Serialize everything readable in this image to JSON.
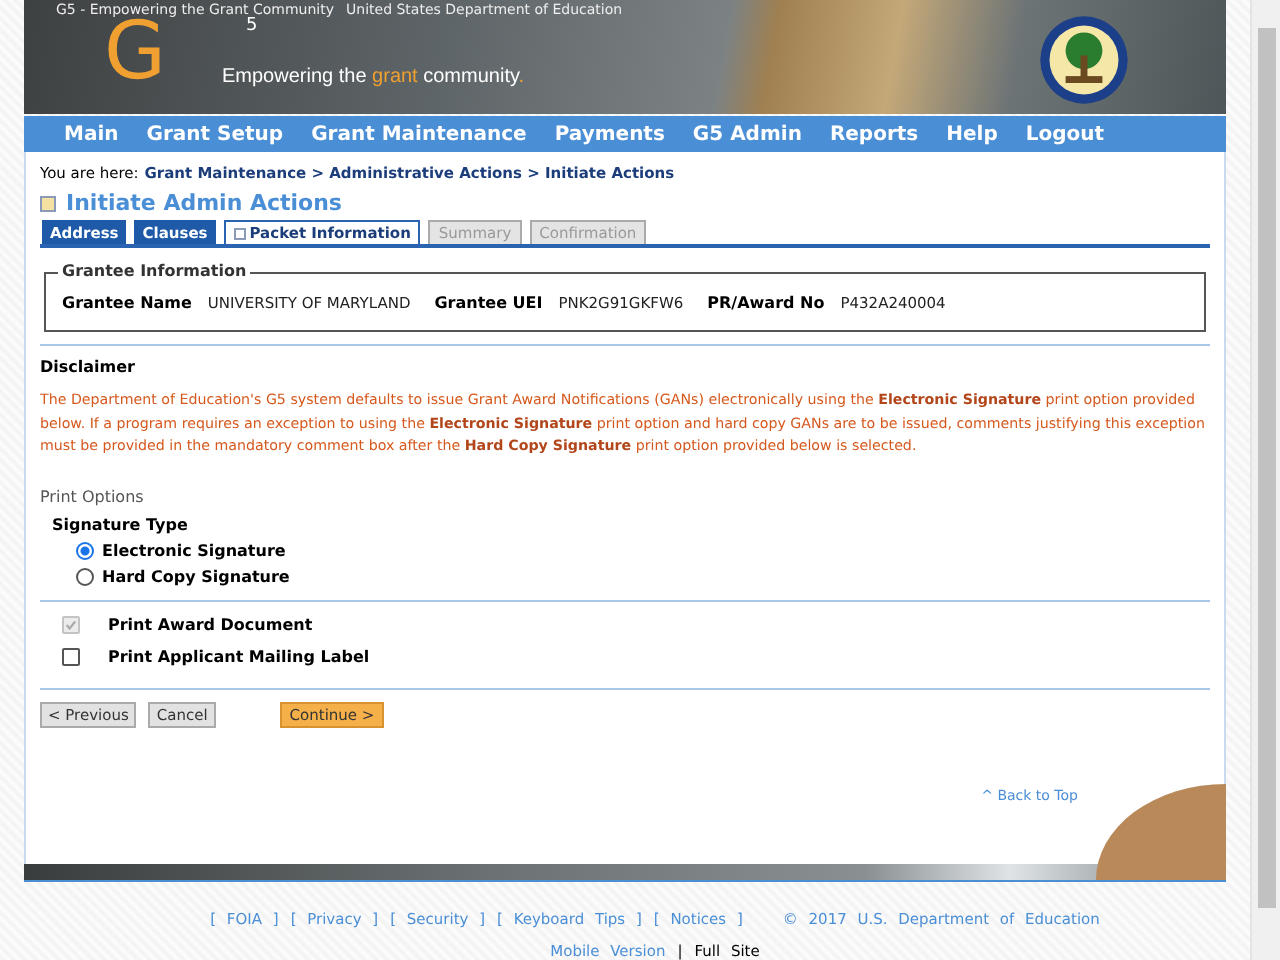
{
  "header": {
    "image_alt_texts": [
      "G5 - Empowering the Grant Community",
      "United States Department of Education"
    ],
    "logo": {
      "letter": "G",
      "superscript": "5"
    },
    "tagline": [
      {
        "text": "Empowering the ",
        "accent": false
      },
      {
        "text": "grant",
        "accent": true
      },
      {
        "text": " community",
        "accent": false
      },
      {
        "text": ".",
        "accent": true
      }
    ]
  },
  "nav": {
    "items": [
      "Main",
      "Grant Setup",
      "Grant Maintenance",
      "Payments",
      "G5 Admin",
      "Reports",
      "Help",
      "Logout"
    ]
  },
  "breadcrumb": {
    "label": "You are here:",
    "path": "Grant Maintenance > Administrative Actions > Initiate Actions"
  },
  "page_title": "Initiate Admin Actions",
  "tabs": [
    {
      "label": "Address",
      "selected": false,
      "disabled": false
    },
    {
      "label": "Clauses",
      "selected": false,
      "disabled": false
    },
    {
      "label": "Packet Information",
      "selected": true,
      "disabled": false
    },
    {
      "label": "Summary",
      "selected": false,
      "disabled": true
    },
    {
      "label": "Confirmation",
      "selected": false,
      "disabled": true
    }
  ],
  "grantee": {
    "legend": "Grantee Information",
    "fields": [
      {
        "label": "Grantee Name",
        "value": "UNIVERSITY OF MARYLAND"
      },
      {
        "label": "Grantee UEI",
        "value": "PNK2G91GKFW6"
      },
      {
        "label": "PR/Award No",
        "value": "P432A240004"
      }
    ]
  },
  "disclaimer": {
    "heading": "Disclaimer",
    "text": "The Department of Education's G5 system defaults to issue Grant Award Notifications (GANs) electronically using the **Electronic Signature** print option provided below. If a program requires an exception to using the **Electronic Signature** print option and hard copy GANs are to be issued, comments justifying this exception must be provided in the mandatory comment box after the **Hard Copy Signature** print option provided below is selected."
  },
  "print_options": {
    "label": "Print Options",
    "signature_type": {
      "label": "Signature Type",
      "options": [
        {
          "label": "Electronic Signature",
          "selected": true
        },
        {
          "label": "Hard Copy Signature",
          "selected": false
        }
      ]
    },
    "checkboxes": [
      {
        "label": "Print Award Document",
        "checked": true,
        "disabled": true
      },
      {
        "label": "Print Applicant Mailing Label",
        "checked": false,
        "disabled": false
      }
    ]
  },
  "buttons": [
    {
      "label": "< Previous",
      "kind": "secondary"
    },
    {
      "label": "Cancel",
      "kind": "secondary"
    },
    {
      "label": "Continue >",
      "kind": "primary"
    }
  ],
  "back_to_top": "^ Back to Top",
  "footer": {
    "links": [
      "[ FOIA ]",
      "[ Privacy ]",
      "[ Security ]",
      "[ Keyboard Tips ]",
      "[ Notices ]"
    ],
    "copyright": "© 2017 U.S. Department of Education",
    "mobile_link": "Mobile Version",
    "separator": "|",
    "full_site": "Full Site"
  }
}
